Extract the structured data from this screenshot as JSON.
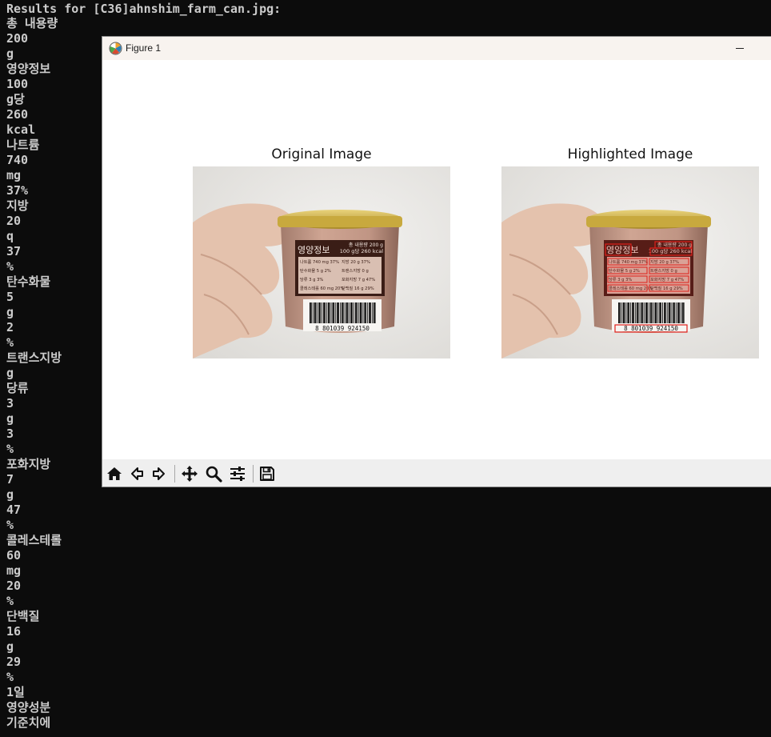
{
  "terminal": {
    "lines": [
      "Results for [C36]ahnshim_farm_can.jpg:",
      "총 내용량",
      "200",
      "g",
      "영양정보",
      "100",
      "g당",
      "260",
      "kcal",
      "나트륨",
      "740",
      "mg",
      "37%",
      "지방",
      "20",
      "q",
      "37",
      "%",
      "탄수화물",
      "5",
      "g",
      "2",
      "%",
      "트랜스지방",
      "g",
      "당류",
      "3",
      "g",
      "3",
      "%",
      "포화지방",
      "7",
      "g",
      "47",
      "%",
      "콜레스테롤",
      "60",
      "mg",
      "20",
      "%",
      "단백질",
      "16",
      "g",
      "29",
      "%",
      "1일",
      "영양성분",
      "기준치에"
    ]
  },
  "window": {
    "title": "Figure 1",
    "icon": "matplotlib-icon"
  },
  "figure": {
    "left_title": "Original Image",
    "right_title": "Highlighted Image",
    "label": {
      "heading": "영양정보",
      "total": "총 내용량 200 g",
      "per": "100 g당 260 kcal",
      "rows": [
        "나트륨 740 mg 37%",
        "지방 20 g 37%",
        "탄수화물 5 g 2%",
        "트랜스지방 0 g",
        "당류 3 g 3%",
        "포화지방 7 g 47%",
        "콜레스테롤 60 mg 20%",
        "단백질 16 g 29%"
      ],
      "barcode": "8 801039 924150"
    }
  },
  "toolbar": {
    "buttons": [
      "home-icon",
      "back-arrow-icon",
      "forward-arrow-icon",
      "pan-icon",
      "zoom-icon",
      "configure-subplots-icon",
      "save-icon"
    ]
  },
  "colors": {
    "terminal_bg": "#0c0c0c",
    "terminal_text": "#cccccc",
    "highlight": "#e0201a"
  }
}
